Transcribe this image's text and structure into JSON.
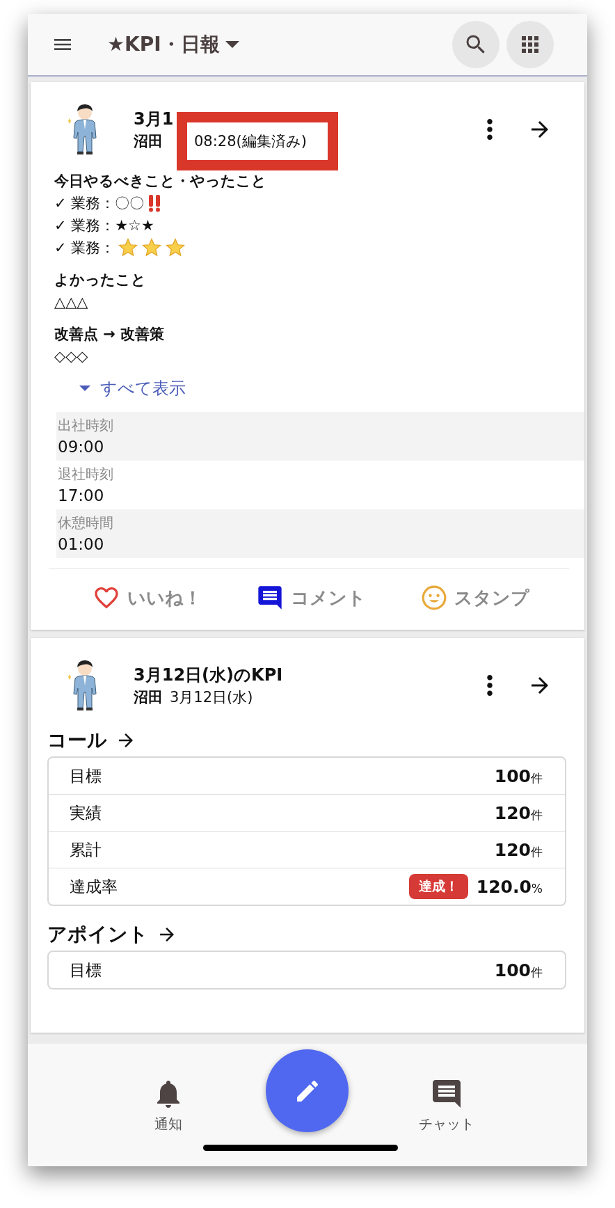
{
  "header": {
    "title": "★KPI・日報"
  },
  "report": {
    "title": "3月1",
    "author": "沼田",
    "callout": "08:28(編集済み)",
    "sections": [
      {
        "heading": "今日やるべきこと・やったこと",
        "lines": [
          {
            "text": "✓ 業務：〇〇",
            "kind": "exclaim"
          },
          {
            "text": "✓ 業務：★☆★",
            "kind": "plain"
          },
          {
            "text": "✓ 業務：",
            "kind": "stars",
            "stars": 3
          }
        ]
      },
      {
        "heading": "よかったこと",
        "lines": [
          {
            "text": "△△△",
            "kind": "plain"
          }
        ]
      },
      {
        "heading": "改善点 → 改善策",
        "lines": [
          {
            "text": "◇◇◇",
            "kind": "plain"
          }
        ]
      }
    ],
    "expand": "すべて表示",
    "fields": [
      {
        "label": "出社時刻",
        "value": "09:00"
      },
      {
        "label": "退社時刻",
        "value": "17:00"
      },
      {
        "label": "休憩時間",
        "value": "01:00"
      }
    ],
    "actions": [
      {
        "label": "いいね！",
        "kind": "like"
      },
      {
        "label": "コメント",
        "kind": "comment"
      },
      {
        "label": "スタンプ",
        "kind": "stamp"
      }
    ]
  },
  "kpi": {
    "title": "3月12日(水)のKPI",
    "author": "沼田",
    "date": "3月12日(水)",
    "groups": [
      {
        "name": "コール",
        "rows": [
          {
            "label": "目標",
            "value": "100",
            "unit": "件"
          },
          {
            "label": "実績",
            "value": "120",
            "unit": "件"
          },
          {
            "label": "累計",
            "value": "120",
            "unit": "件"
          },
          {
            "label": "達成率",
            "badge": "達成！",
            "value": "120.0",
            "unit": "%"
          }
        ]
      },
      {
        "name": "アポイント",
        "rows": [
          {
            "label": "目標",
            "value": "100",
            "unit": "件"
          }
        ]
      }
    ]
  },
  "bottom_nav": [
    {
      "label": "通知",
      "kind": "bell"
    },
    {
      "label": "チャット",
      "kind": "chat"
    }
  ]
}
